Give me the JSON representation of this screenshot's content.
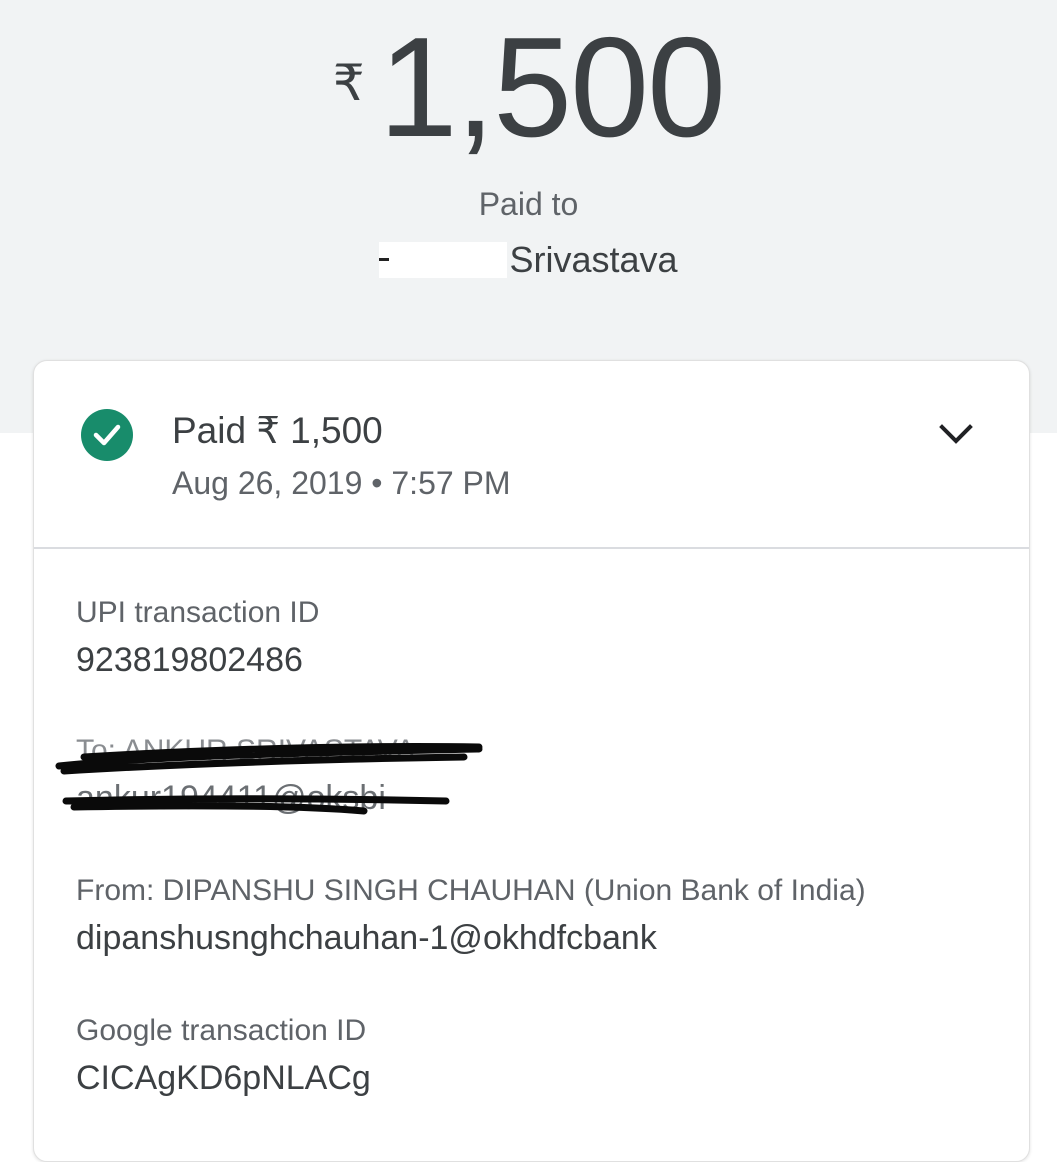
{
  "header": {
    "currency_symbol": "₹",
    "amount": "1,500",
    "paid_to_label": "Paid to",
    "payee_name": "Srivastava"
  },
  "status": {
    "title": "Paid ₹ 1,500",
    "date_time": "Aug 26, 2019 • 7:57 PM",
    "icon": "check-circle-icon",
    "icon_color": "#188c6b"
  },
  "details": {
    "upi_label": "UPI transaction ID",
    "upi_value": "923819802486",
    "to_label": "To: ANKUR SRIVASTAVA",
    "to_value": "ankur194411@oksbi",
    "from_label": "From: DIPANSHU SINGH CHAUHAN (Union Bank of India)",
    "from_value": "dipanshusnghchauhan-1@okhdfcbank",
    "google_label": "Google transaction ID",
    "google_value": "CICAgKD6pNLACg"
  }
}
